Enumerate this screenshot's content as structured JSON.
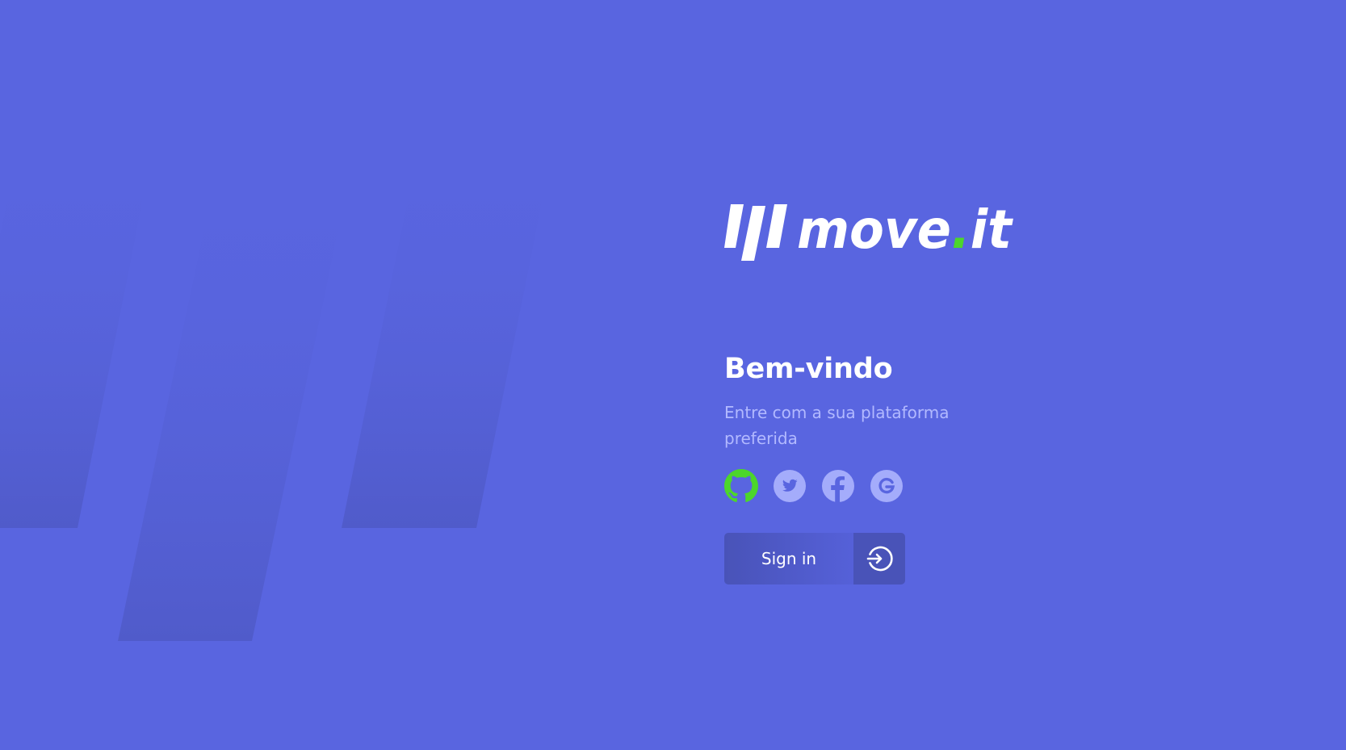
{
  "colors": {
    "background": "#5965E0",
    "stripe": "#4953B8",
    "text_primary": "#FFFFFF",
    "text_secondary": "#B2B9FF",
    "accent_green": "#4CD62B",
    "provider_inactive": "#B2B9FF",
    "button": "#4953B8"
  },
  "brand": {
    "word": "move",
    "dot": ".",
    "suffix": "it"
  },
  "login": {
    "title": "Bem-vindo",
    "subtitle": "Entre com a sua plataforma preferida",
    "providers": [
      {
        "name": "GitHub",
        "icon": "github-icon",
        "selected": true
      },
      {
        "name": "Twitter",
        "icon": "twitter-icon",
        "selected": false
      },
      {
        "name": "Facebook",
        "icon": "facebook-icon",
        "selected": false
      },
      {
        "name": "Google",
        "icon": "google-icon",
        "selected": false
      }
    ],
    "signin_label": "Sign in",
    "signin_icon": "arrow-right-circle-icon"
  }
}
